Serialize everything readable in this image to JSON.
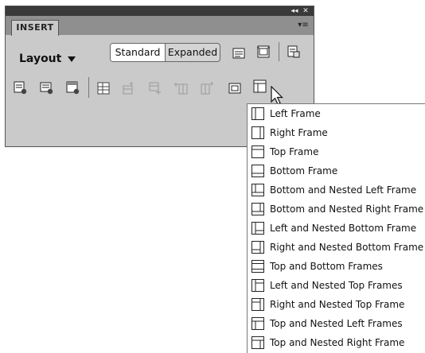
{
  "panel": {
    "tab_label": "INSERT",
    "collapse_glyph": "◂◂",
    "close_glyph": "✕",
    "options_glyph": "▾≡",
    "category_label": "Layout",
    "mode_standard": "Standard",
    "mode_expanded": "Expanded",
    "selected_mode": "Standard"
  },
  "toolbar_icons": [
    "div-tag-icon",
    "insert-ap-div-icon",
    "insert-spry-icon",
    "table-icon",
    "insert-row-above-icon",
    "insert-row-below-icon",
    "insert-column-left-icon",
    "insert-column-right-icon",
    "iframe-icon",
    "frames-icon"
  ],
  "frames_menu": {
    "items": [
      {
        "label": "Left Frame",
        "icon": "left-frame-icon"
      },
      {
        "label": "Right Frame",
        "icon": "right-frame-icon"
      },
      {
        "label": "Top Frame",
        "icon": "top-frame-icon"
      },
      {
        "label": "Bottom Frame",
        "icon": "bottom-frame-icon"
      },
      {
        "label": "Bottom and Nested Left Frame",
        "icon": "bottom-nested-left-frame-icon"
      },
      {
        "label": "Bottom and Nested Right Frame",
        "icon": "bottom-nested-right-frame-icon"
      },
      {
        "label": "Left and Nested Bottom Frame",
        "icon": "left-nested-bottom-frame-icon"
      },
      {
        "label": "Right and Nested Bottom Frame",
        "icon": "right-nested-bottom-frame-icon"
      },
      {
        "label": "Top and Bottom Frames",
        "icon": "top-bottom-frames-icon"
      },
      {
        "label": "Left and Nested Top Frames",
        "icon": "left-nested-top-frames-icon"
      },
      {
        "label": "Right and Nested Top Frame",
        "icon": "right-nested-top-frame-icon"
      },
      {
        "label": "Top and Nested Left Frames",
        "icon": "top-nested-left-frames-icon"
      },
      {
        "label": "Top and Nested Right Frame",
        "icon": "top-nested-right-frame-icon"
      }
    ]
  },
  "colors": {
    "panel_bg": "#cacaca",
    "titlebar": "#3a3a3a",
    "tabstrip": "#8f8f8f"
  }
}
